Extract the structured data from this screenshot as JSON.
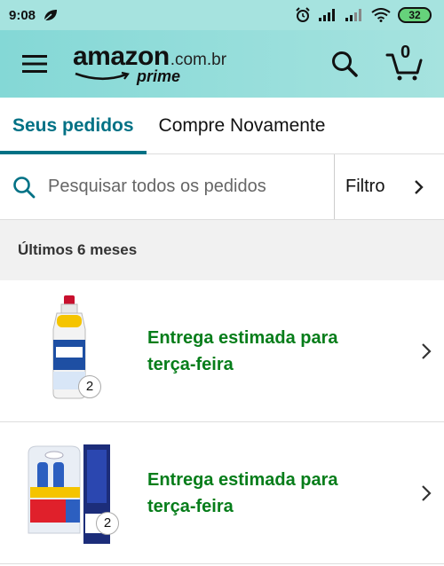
{
  "status_bar": {
    "time": "9:08",
    "battery": "32",
    "icons": [
      "leaf-icon",
      "alarm-icon",
      "signal-icon",
      "signal-icon",
      "wifi-icon",
      "battery-icon"
    ]
  },
  "header": {
    "logo_word": "amazon",
    "logo_domain": ".com.br",
    "logo_sub": "prime",
    "cart_count": "0",
    "icons": [
      "menu-icon",
      "search-icon",
      "cart-icon"
    ],
    "colors": {
      "header_bg": "#84d8d6",
      "accent": "#007185"
    }
  },
  "tabs": [
    {
      "label": "Seus pedidos",
      "active": true
    },
    {
      "label": "Compre Novamente",
      "active": false
    }
  ],
  "search": {
    "placeholder": "Pesquisar todos os pedidos",
    "value": "",
    "filter_label": "Filtro"
  },
  "section": {
    "title": "Últimos 6 meses"
  },
  "orders": [
    {
      "status_line1": "Entrega estimada para",
      "status_line2": "terça-feira",
      "quantity": "2",
      "image": "veja-bottle-image"
    },
    {
      "status_line1": "Entrega estimada para",
      "status_line2": "terça-feira",
      "quantity": "2",
      "image": "veja-kit-image"
    }
  ],
  "colors": {
    "status_green": "#067d1a"
  }
}
